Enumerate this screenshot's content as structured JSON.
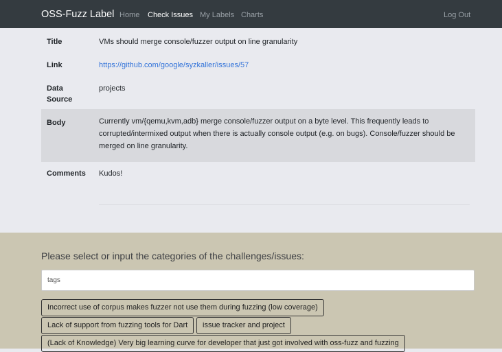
{
  "nav": {
    "brand": "OSS-Fuzz Label",
    "links": [
      "Home",
      "Check Issues",
      "My Labels",
      "Charts"
    ],
    "active": "Check Issues",
    "logout": "Log Out"
  },
  "issue": {
    "title_label": "Title",
    "title": "VMs should merge console/fuzzer output on line granularity",
    "link_label": "Link",
    "link": "https://github.com/google/syzkaller/issues/57",
    "source_label_line1": "Data",
    "source_label_line2": "Source",
    "source": "projects",
    "body_label": "Body",
    "body_line1": "Currently vm/{qemu,kvm,adb} merge console/fuzzer output on a byte level. This frequently leads to",
    "body_line2": "corrupted/intermixed output when there is actually console output (e.g. on bugs). Console/fuzzer should be",
    "body_line3": "merged on line granularity.",
    "comments_label": "Comments",
    "comments": "Kudos!"
  },
  "tagging": {
    "prompt": "Please select or input the categories of the challenges/issues:",
    "placeholder": "tags",
    "chips": [
      "Incorrect use of corpus makes fuzzer not use them during fuzzing (low coverage)",
      "Lack of support from fuzzing tools for Dart",
      "issue tracker and project",
      "(Lack of Knowledge) Very big learning curve for developer that just got involved with oss-fuzz and fuzzing"
    ]
  },
  "colors": {
    "navbar": "#343b40",
    "accent_link": "#3273d9",
    "tag_panel": "#cbc6b2",
    "shaded_row": "#d8d9dd"
  }
}
